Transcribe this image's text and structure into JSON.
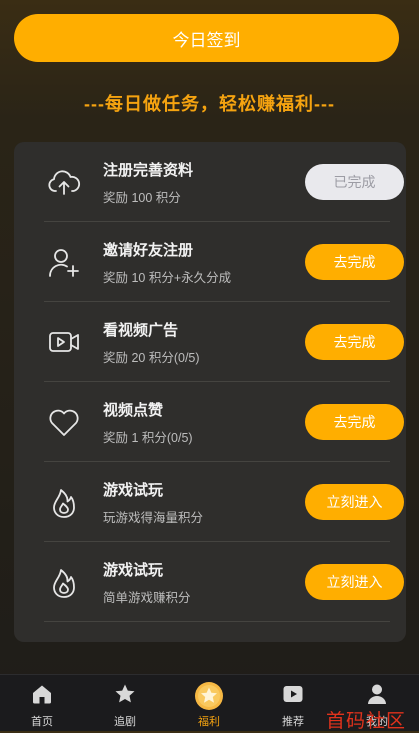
{
  "signin_button": "今日签到",
  "slogan": "---每日做任务，轻松赚福利---",
  "tasks": [
    {
      "icon": "cloud-upload-icon",
      "title": "注册完善资料",
      "reward": "奖励 100 积分",
      "button": "已完成",
      "done": true
    },
    {
      "icon": "add-user-icon",
      "title": "邀请好友注册",
      "reward": "奖励 10 积分+永久分成",
      "button": "去完成",
      "done": false
    },
    {
      "icon": "video-camera-icon",
      "title": "看视频广告",
      "reward": "奖励 20 积分(0/5)",
      "button": "去完成",
      "done": false
    },
    {
      "icon": "heart-icon",
      "title": "视频点赞",
      "reward": "奖励 1 积分(0/5)",
      "button": "去完成",
      "done": false
    },
    {
      "icon": "flame-icon",
      "title": "游戏试玩",
      "reward": "玩游戏得海量积分",
      "button": "立刻进入",
      "done": false
    },
    {
      "icon": "flame-icon",
      "title": "游戏试玩",
      "reward": "简单游戏赚积分",
      "button": "立刻进入",
      "done": false
    }
  ],
  "tabs": [
    {
      "icon": "home-icon",
      "label": "首页",
      "active": false
    },
    {
      "icon": "star-icon",
      "label": "追剧",
      "active": false
    },
    {
      "icon": "welfare-star-coin-icon",
      "label": "福利",
      "active": true
    },
    {
      "icon": "play-icon",
      "label": "推荐",
      "active": false
    },
    {
      "icon": "user-icon",
      "label": "我的",
      "active": false
    }
  ],
  "colors": {
    "accent": "#ffae00",
    "slogan": "#f5a310",
    "panel": "#2f2e2c",
    "done_button": "#e9e9ed"
  },
  "watermark": "首码社区"
}
